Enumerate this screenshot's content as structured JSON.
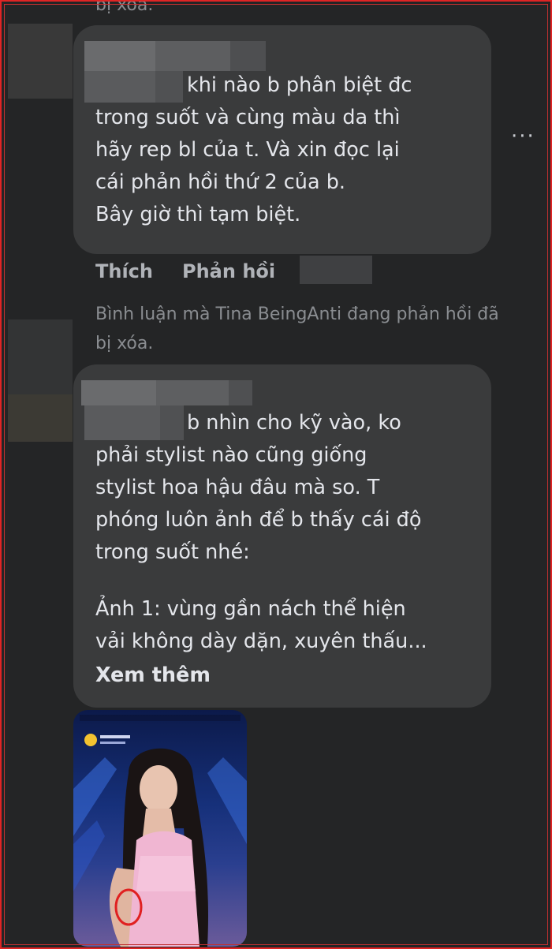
{
  "top_partial": "bị xóa.",
  "comment1": {
    "text": "khi nào b phân biệt đc\ntrong suốt và cùng màu da thì\nhãy rep bl của t. Và xin đọc lại\ncái phản hồi thứ 2 của b.\nBây giờ thì tạm biệt."
  },
  "actions": {
    "like": "Thích",
    "reply": "Phản hồi",
    "more": "···"
  },
  "deleted_note": {
    "line1": "Bình luận mà Tina BeingAnti đang phản hồi đã",
    "line2": "bị xóa."
  },
  "comment2": {
    "text": "b nhìn cho kỹ vào, ko\nphải stylist nào cũng giống\nstylist hoa hậu đâu mà so. T\nphóng luôn ảnh để b thấy cái độ\ntrong suốt nhé:",
    "text2": "Ảnh 1: vùng gần nách thể hiện\nvải không dày dặn, xuyên thấu...",
    "see_more": "Xem thêm"
  },
  "colors": {
    "background": "#242526",
    "bubble": "#3a3b3c",
    "text": "#e4e6eb",
    "muted": "#b0b3b8",
    "frame": "#e02424"
  }
}
